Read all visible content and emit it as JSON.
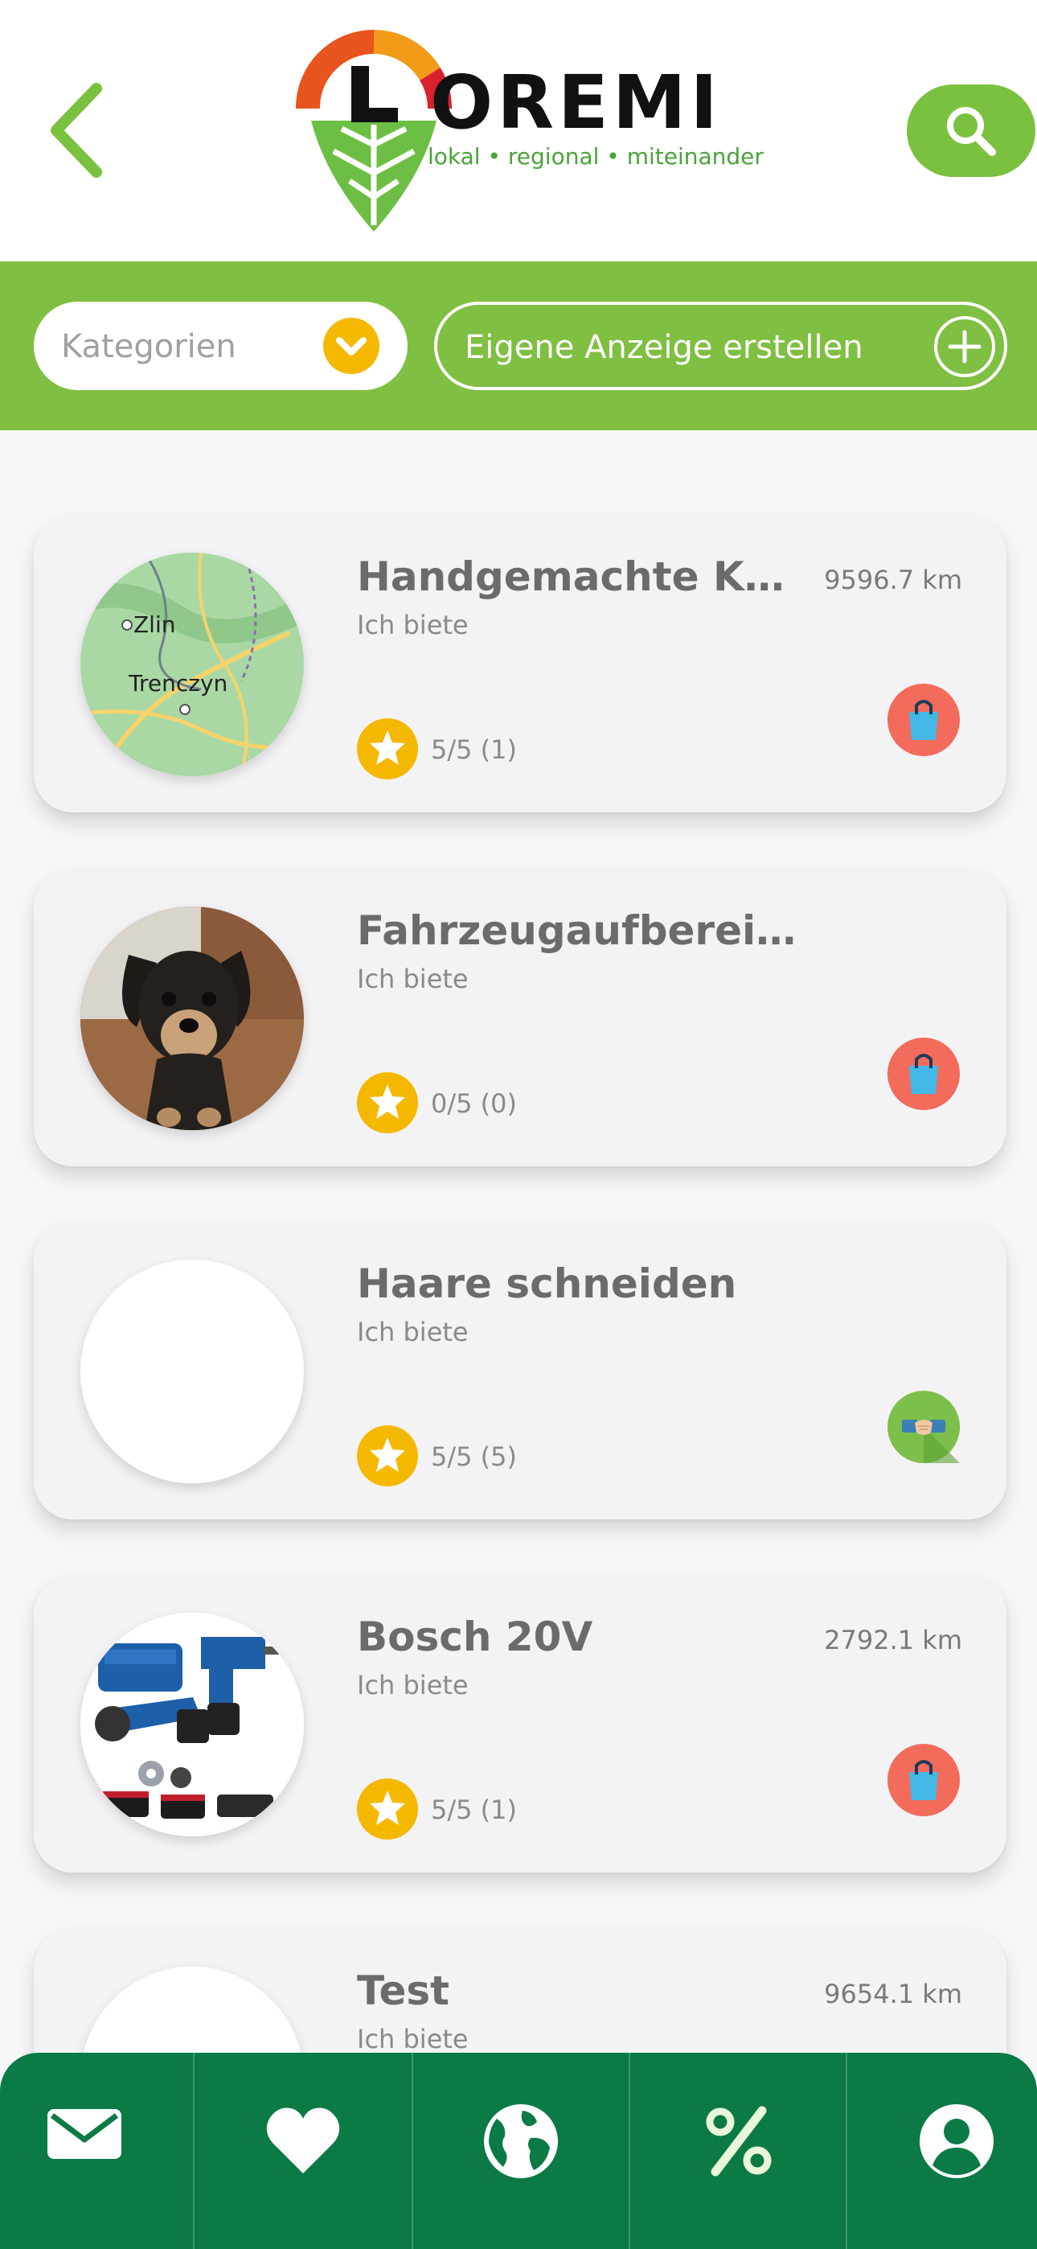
{
  "header": {
    "back_icon": "chevron-left-icon",
    "logo": {
      "word": "OREMI",
      "brand": "LOREMI",
      "tagline": "lokal • regional • miteinander"
    },
    "search_icon": "search-icon"
  },
  "filters": {
    "category_placeholder": "Kategorien",
    "create_label": "Eigene Anzeige erstellen"
  },
  "listings": [
    {
      "title": "Handgemachte Kart...",
      "subtitle": "Ich biete",
      "distance": "9596.7 km",
      "rating": "5/5 (1)",
      "badge": "shopping-bag-icon",
      "image": "map-image",
      "map_labels": [
        "Zlin",
        "Trenczyn"
      ]
    },
    {
      "title": "Fahrzeugaufbereitung",
      "subtitle": "Ich biete",
      "distance": "",
      "rating": "0/5 (0)",
      "badge": "shopping-bag-icon",
      "image": "dog-photo"
    },
    {
      "title": "Haare schneiden",
      "subtitle": "Ich biete",
      "distance": "",
      "rating": "5/5 (5)",
      "badge": "handshake-icon",
      "image": "empty"
    },
    {
      "title": "Bosch 20V",
      "subtitle": "Ich biete",
      "distance": "2792.1 km",
      "rating": "5/5 (1)",
      "badge": "shopping-bag-icon",
      "image": "power-tools-photo"
    },
    {
      "title": "Test",
      "subtitle": "Ich biete",
      "distance": "9654.1 km",
      "rating": "",
      "badge": "",
      "image": "empty"
    }
  ],
  "bottom_nav": [
    {
      "name": "messages",
      "icon": "mail-icon"
    },
    {
      "name": "favorites",
      "icon": "heart-icon"
    },
    {
      "name": "explore",
      "icon": "globe-icon"
    },
    {
      "name": "offers",
      "icon": "percent-icon"
    },
    {
      "name": "profile",
      "icon": "profile-icon"
    }
  ],
  "colors": {
    "primary_green": "#7fbf41",
    "nav_green": "#0b7a45",
    "star_yellow": "#f5b800",
    "bag_red": "#f26b5b",
    "bag_blue": "#43b8e6"
  }
}
